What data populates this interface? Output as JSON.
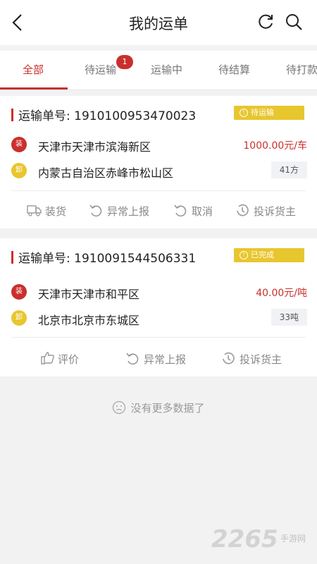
{
  "header": {
    "title": "我的运单",
    "icons": [
      "chevron-left-icon",
      "refresh-icon",
      "search-icon"
    ]
  },
  "tabs": [
    {
      "label": "全部",
      "active": true
    },
    {
      "label": "待运输",
      "badge": "1"
    },
    {
      "label": "运输中"
    },
    {
      "label": "待结算"
    },
    {
      "label": "待打款"
    }
  ],
  "orders": [
    {
      "waybill": "运输单号: 1910100953470023",
      "status": "待运输",
      "load_tag": "装",
      "load_address": "天津市天津市滨海新区",
      "price": "1000.00元/车",
      "unload_tag": "卸",
      "unload_address": "内蒙古自治区赤峰市松山区",
      "quantity": "41方",
      "actions": [
        "装货",
        "异常上报",
        "取消",
        "投诉货主"
      ]
    },
    {
      "waybill": "运输单号: 1910091544506331",
      "status": "已完成",
      "load_tag": "装",
      "load_address": "天津市天津市和平区",
      "price": "40.00元/吨",
      "unload_tag": "卸",
      "unload_address": "北京市北京市东城区",
      "quantity": "33吨",
      "actions": [
        "评价",
        "异常上报",
        "投诉货主"
      ]
    }
  ],
  "footer": {
    "no_more": "没有更多数据了"
  },
  "watermark": {
    "number": "2265",
    "text": "手游网"
  },
  "colors": {
    "accent": "#c9302c",
    "status": "#e8c62e"
  }
}
